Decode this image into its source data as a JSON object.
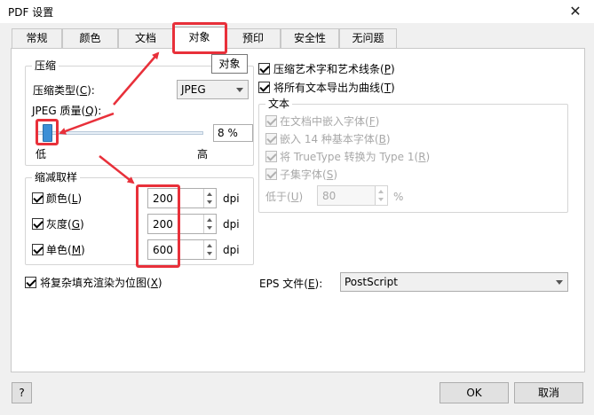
{
  "window": {
    "title": "PDF 设置",
    "close_glyph": "✕"
  },
  "tabs": [
    {
      "label": "常规",
      "active": false
    },
    {
      "label": "颜色",
      "active": false
    },
    {
      "label": "文档",
      "active": false
    },
    {
      "label": "对象",
      "active": true
    },
    {
      "label": "预印",
      "active": false
    },
    {
      "label": "安全性",
      "active": false
    },
    {
      "label": "无问题",
      "active": false
    }
  ],
  "tooltip": "对象",
  "compression": {
    "legend": "压缩",
    "type_label": "压缩类型(",
    "type_key": "C",
    "type_suffix": "):",
    "type_value": "JPEG",
    "quality_label": "JPEG 质量(",
    "quality_key": "Q",
    "quality_suffix": "):",
    "quality_value": "8 %",
    "quality_level": 0.08,
    "low_label": "低",
    "high_label": "高"
  },
  "downsample": {
    "legend": "缩减取样",
    "rows": [
      {
        "label": "颜色(",
        "key": "L",
        "suffix": ")",
        "checked": true,
        "value": "200",
        "unit": "dpi"
      },
      {
        "label": "灰度(",
        "key": "G",
        "suffix": ")",
        "checked": true,
        "value": "200",
        "unit": "dpi"
      },
      {
        "label": "单色(",
        "key": "M",
        "suffix": ")",
        "checked": true,
        "value": "600",
        "unit": "dpi"
      }
    ]
  },
  "rasterize": {
    "label": "将复杂填充渲染为位图(",
    "key": "X",
    "suffix": ")",
    "checked": true
  },
  "right": {
    "compress_art": {
      "label": "压缩艺术字和艺术线条(",
      "key": "P",
      "suffix": ")",
      "checked": true
    },
    "export_curves": {
      "label": "将所有文本导出为曲线(",
      "key": "T",
      "suffix": ")",
      "checked": true
    },
    "text_group": {
      "legend": "文本",
      "embed_fonts": {
        "label": "在文档中嵌入字体(",
        "key": "F",
        "suffix": ")",
        "checked": true
      },
      "embed_base14": {
        "label": "嵌入 14 种基本字体(",
        "key": "B",
        "suffix": ")",
        "checked": true
      },
      "truetype": {
        "label": "将 TrueType 转换为 Type 1(",
        "key": "R",
        "suffix": ")",
        "checked": true
      },
      "subset": {
        "label": "子集字体(",
        "key": "S",
        "suffix": ")",
        "checked": true
      },
      "below_label": "低于(",
      "below_key": "U",
      "below_suffix": ")",
      "below_value": "80",
      "below_unit": "%"
    }
  },
  "eps": {
    "label": "EPS 文件(",
    "key": "E",
    "suffix": "):",
    "value": "PostScript"
  },
  "footer": {
    "help": "?",
    "ok": "OK",
    "cancel": "取消"
  },
  "colors": {
    "accent_red": "#e8303a",
    "thumb_blue": "#3c8fd6"
  }
}
